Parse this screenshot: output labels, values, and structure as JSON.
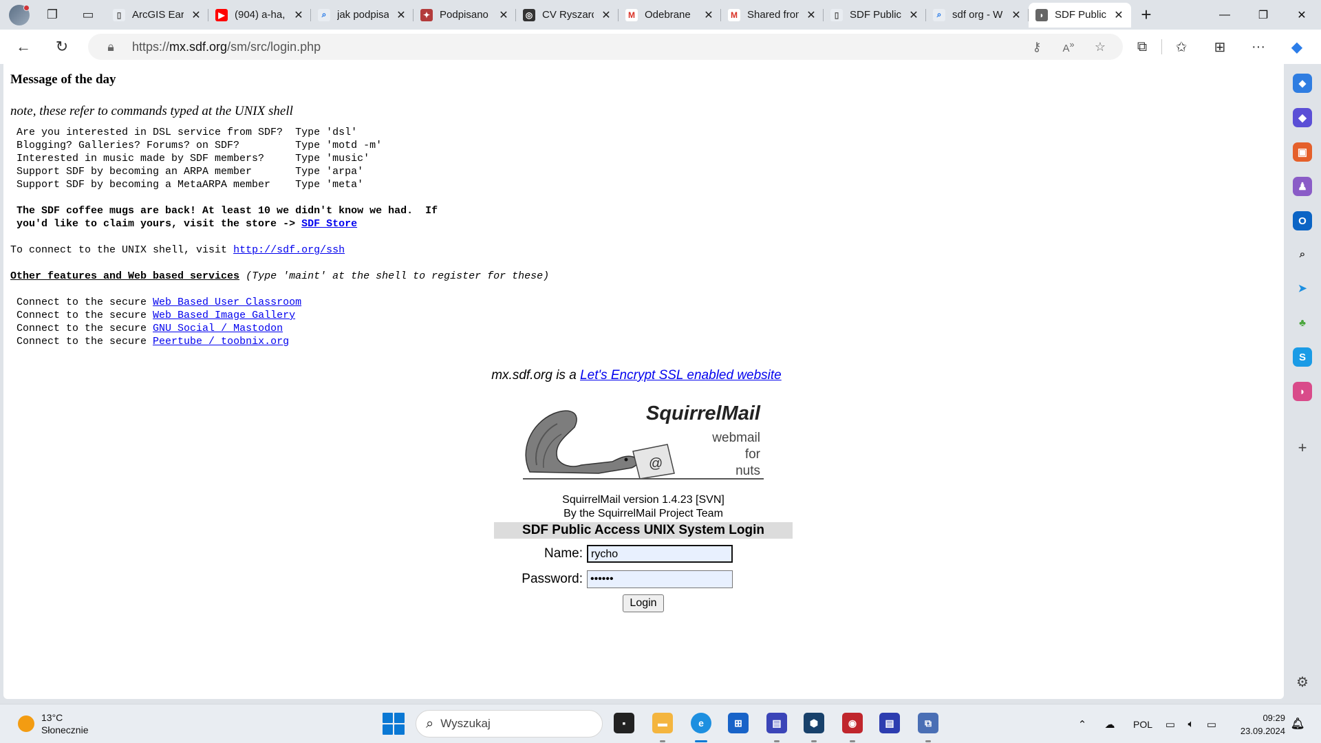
{
  "browser": {
    "tabs": [
      {
        "title": "ArcGIS Earth",
        "favicon": "doc-icon"
      },
      {
        "title": "(904) a-ha, ...",
        "favicon": "youtube-icon"
      },
      {
        "title": "jak podpisać",
        "favicon": "search-icon"
      },
      {
        "title": "Podpisano",
        "favicon": "emblem-icon"
      },
      {
        "title": "CV Ryszard",
        "favicon": "ssl-icon"
      },
      {
        "title": "Odebrane",
        "favicon": "gmail-icon"
      },
      {
        "title": "Shared from",
        "favicon": "gmail-icon"
      },
      {
        "title": "SDF Public",
        "favicon": "doc-icon"
      },
      {
        "title": "sdf org - W",
        "favicon": "search-icon"
      },
      {
        "title": "SDF Public",
        "favicon": "squirrelmail-icon",
        "active": true
      }
    ],
    "url_prefix": "https://",
    "url_host": "mx.sdf.org",
    "url_path": "/sm/src/login.php"
  },
  "page": {
    "motd_title": "Message of the day",
    "motd_note": "note, these refer to commands typed at the UNIX shell",
    "commands": [
      {
        "q": "Are you interested in DSL service from SDF?",
        "cmd": "Type 'dsl'"
      },
      {
        "q": "Blogging? Galleries? Forums? on SDF?",
        "cmd": "Type 'motd -m'"
      },
      {
        "q": "Interested in music made by SDF members?",
        "cmd": "Type 'music'"
      },
      {
        "q": "Support SDF by becoming an ARPA member",
        "cmd": "Type 'arpa'"
      },
      {
        "q": "Support SDF by becoming a MetaARPA member",
        "cmd": "Type 'meta'"
      }
    ],
    "mugs_line1": "The SDF coffee mugs are back! At least 10 we didn't know we had.  If",
    "mugs_line2": "you'd like to claim yours, visit the store -> ",
    "mugs_link": "SDF Store",
    "ssh_prefix": "To connect to the UNIX shell, visit ",
    "ssh_link": "http://sdf.org/ssh",
    "features_title": "Other features and Web based services",
    "features_note": " (Type 'maint' at the shell to register for these)",
    "services_prefix": "Connect to the secure ",
    "services": [
      "Web Based User Classroom",
      "Web Based Image Gallery",
      "GNU Social / Mastodon",
      "Peertube / toobnix.org"
    ],
    "ssl_prefix": "mx.sdf.org is a ",
    "ssl_link": "Let's Encrypt SSL enabled website",
    "logo_title": "SquirrelMail",
    "logo_tag1": "webmail",
    "logo_tag2": "for",
    "logo_tag3": "nuts",
    "version": "SquirrelMail version 1.4.23 [SVN]",
    "team": "By the SquirrelMail Project Team",
    "login_title": "SDF Public Access UNIX System Login",
    "name_label": "Name:",
    "name_value": "rycho",
    "password_label": "Password:",
    "password_value": "••••••",
    "login_button": "Login"
  },
  "taskbar": {
    "temperature": "13°C",
    "weather": "Słonecznie",
    "search_placeholder": "Wyszukaj",
    "language": "POL",
    "time": "09:29",
    "date": "23.09.2024"
  }
}
